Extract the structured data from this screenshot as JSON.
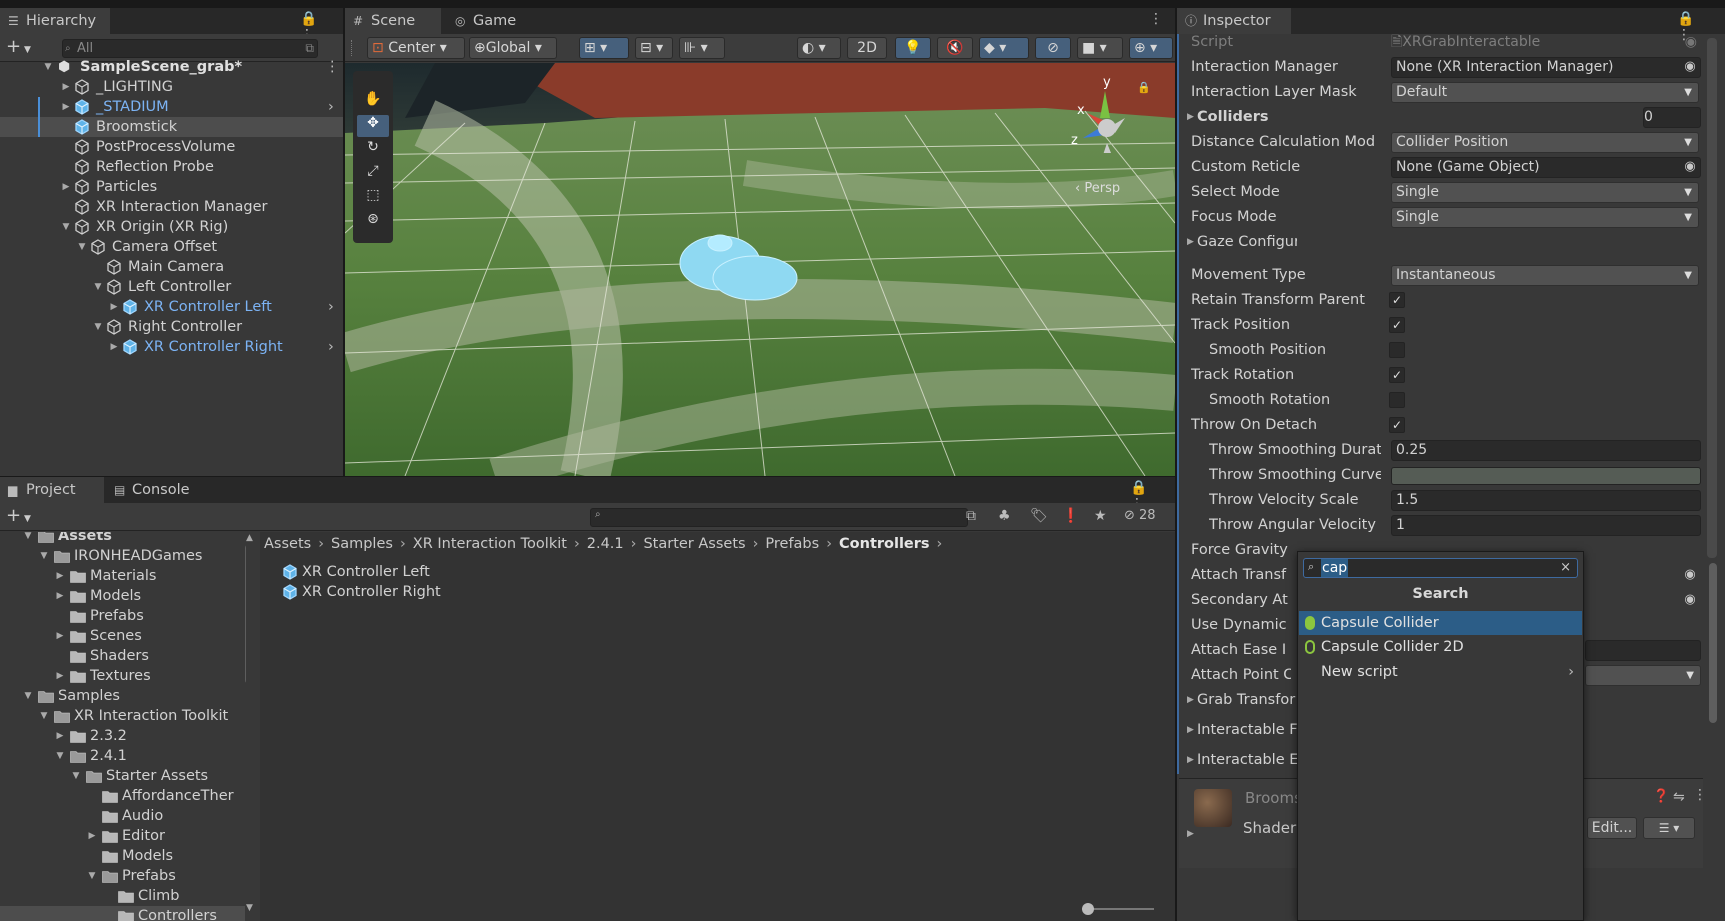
{
  "hierarchy": {
    "tab_label": "Hierarchy",
    "search_placeholder": "All",
    "scene_name": "SampleScene_grab*",
    "items": [
      {
        "label": "_LIGHTING"
      },
      {
        "label": "_STADIUM"
      },
      {
        "label": "Broomstick"
      },
      {
        "label": "PostProcessVolume"
      },
      {
        "label": "Reflection Probe"
      },
      {
        "label": "Particles"
      },
      {
        "label": "XR Interaction Manager"
      },
      {
        "label": "XR Origin (XR Rig)"
      },
      {
        "label": "Camera Offset"
      },
      {
        "label": "Main Camera"
      },
      {
        "label": "Left Controller"
      },
      {
        "label": "XR Controller Left"
      },
      {
        "label": "Right Controller"
      },
      {
        "label": "XR Controller Right"
      }
    ]
  },
  "scene_view": {
    "tab_scene": "Scene",
    "tab_game": "Game",
    "pivot_label": "Center",
    "space_label": "Global",
    "mode_2d": "2D",
    "persp_label": "Persp",
    "gizmo_y": "y",
    "gizmo_x": "x",
    "gizmo_z": "z"
  },
  "project": {
    "tab_project": "Project",
    "tab_console": "Console",
    "hidden_count": "28",
    "tree": [
      {
        "label": "Assets"
      },
      {
        "label": "IRONHEADGames"
      },
      {
        "label": "Materials"
      },
      {
        "label": "Models"
      },
      {
        "label": "Prefabs"
      },
      {
        "label": "Scenes"
      },
      {
        "label": "Shaders"
      },
      {
        "label": "Textures"
      },
      {
        "label": "Samples"
      },
      {
        "label": "XR Interaction Toolkit"
      },
      {
        "label": "2.3.2"
      },
      {
        "label": "2.4.1"
      },
      {
        "label": "Starter Assets"
      },
      {
        "label": "AffordanceTher"
      },
      {
        "label": "Audio"
      },
      {
        "label": "Editor"
      },
      {
        "label": "Models"
      },
      {
        "label": "Prefabs"
      },
      {
        "label": "Climb"
      },
      {
        "label": "Controllers"
      }
    ],
    "breadcrumb": [
      "Assets",
      "Samples",
      "XR Interaction Toolkit",
      "2.4.1",
      "Starter Assets",
      "Prefabs",
      "Controllers"
    ],
    "files": [
      {
        "label": "XR Controller Left"
      },
      {
        "label": "XR Controller Right"
      }
    ]
  },
  "inspector": {
    "tab_label": "Inspector",
    "rows": {
      "script": {
        "label": "Script",
        "value": "XRGrabInteractable"
      },
      "interaction_manager": {
        "label": "Interaction Manager",
        "value": "None (XR Interaction Manager)"
      },
      "interaction_layer_mask": {
        "label": "Interaction Layer Mask",
        "value": "Default"
      },
      "colliders": {
        "label": "Colliders",
        "value": "0"
      },
      "distance_calc": {
        "label": "Distance Calculation Mod",
        "value": "Collider Position"
      },
      "custom_reticle": {
        "label": "Custom Reticle",
        "value": "None (Game Object)"
      },
      "select_mode": {
        "label": "Select Mode",
        "value": "Single"
      },
      "focus_mode": {
        "label": "Focus Mode",
        "value": "Single"
      },
      "gaze_config": {
        "label": "Gaze Configuration"
      },
      "movement_type": {
        "label": "Movement Type",
        "value": "Instantaneous"
      },
      "retain_transform_parent": {
        "label": "Retain Transform Parent",
        "checked": true
      },
      "track_position": {
        "label": "Track Position",
        "checked": true
      },
      "smooth_position": {
        "label": "Smooth Position",
        "checked": false
      },
      "track_rotation": {
        "label": "Track Rotation",
        "checked": true
      },
      "smooth_rotation": {
        "label": "Smooth Rotation",
        "checked": false
      },
      "throw_on_detach": {
        "label": "Throw On Detach",
        "checked": true
      },
      "throw_smoothing_duration": {
        "label": "Throw Smoothing Durat",
        "value": "0.25"
      },
      "throw_smoothing_curve": {
        "label": "Throw Smoothing Curve"
      },
      "throw_velocity_scale": {
        "label": "Throw Velocity Scale",
        "value": "1.5"
      },
      "throw_angular_velocity": {
        "label": "Throw Angular Velocity",
        "value": "1"
      },
      "force_gravity": {
        "label": "Force Gravity On Detach"
      },
      "attach_transform": {
        "label": "Attach Transf"
      },
      "secondary_attach": {
        "label": "Secondary At"
      },
      "use_dynamic": {
        "label": "Use Dynamic"
      },
      "attach_ease": {
        "label": "Attach Ease I"
      },
      "attach_point": {
        "label": "Attach Point C"
      },
      "grab_transformers": {
        "label": "Grab Transfor"
      },
      "interactable_filters": {
        "label": "Interactable F"
      },
      "interactable_events": {
        "label": "Interactable E"
      }
    },
    "material": {
      "name": "Brooms",
      "shader_label": "Shader",
      "edit_button": "Edit..."
    }
  },
  "add_component_popup": {
    "query": "cap",
    "header": "Search",
    "items": [
      {
        "label": "Capsule Collider"
      },
      {
        "label": "Capsule Collider 2D"
      },
      {
        "label": "New script"
      }
    ]
  },
  "colors": {
    "accent": "#2c5d87",
    "prefab_blue": "#7cb3f4",
    "panel_bg": "#383838"
  }
}
